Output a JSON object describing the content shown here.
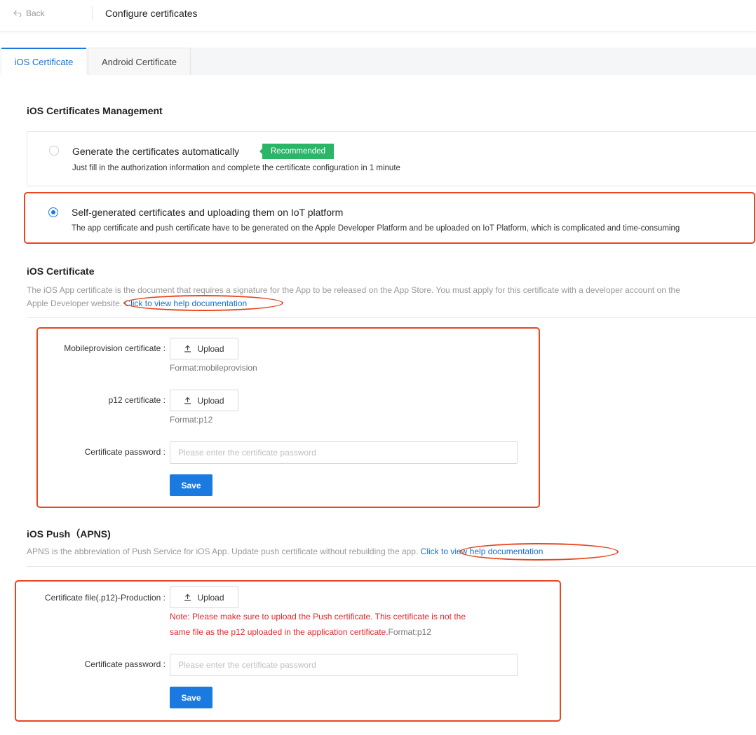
{
  "header": {
    "back_label": "Back",
    "title": "Configure certificates"
  },
  "tabs": [
    {
      "label": "iOS Certificate",
      "active": true
    },
    {
      "label": "Android Certificate",
      "active": false
    }
  ],
  "management": {
    "title": "iOS Certificates Management",
    "options": [
      {
        "title": "Generate the certificates automatically",
        "badge": "Recommended",
        "description": "Just fill in the authorization information and complete the certificate configuration in 1 minute",
        "selected": false
      },
      {
        "title": "Self-generated certificates and uploading them on IoT platform",
        "description": "The app certificate and push certificate have to be generated on the Apple Developer Platform and be uploaded on IoT Platform, which is complicated and time-consuming",
        "selected": true
      }
    ]
  },
  "ios_certificate": {
    "title": "iOS Certificate",
    "description_line1": "The iOS App certificate is the document that requires a signature for the App to be released on the App Store. You must apply for this certificate with a developer account on the",
    "description_line2": "Apple Developer website.",
    "help_link": "Click to view help documentation",
    "fields": {
      "mobileprovision_label": "Mobileprovision certificate :",
      "mobileprovision_format": "Format:mobileprovision",
      "p12_label": "p12 certificate :",
      "p12_format": "Format:p12",
      "password_label": "Certificate password :",
      "password_placeholder": "Please enter the certificate password",
      "password_value": ""
    },
    "upload_label": "Upload",
    "save_label": "Save"
  },
  "ios_push": {
    "title": "iOS Push（APNS)",
    "description": "APNS is the abbreviation of Push Service for iOS App. Update push certificate without rebuilding the app.",
    "help_link": "Click to view help documentation",
    "fields": {
      "cert_file_label": "Certificate file(.p12)-Production :",
      "note_line1": "Note: Please make sure to upload the Push certificate. This certificate is not the",
      "note_line2": "same file as the p12 uploaded in the application certificate.",
      "note_format": "Format:p12",
      "password_label": "Certificate password :",
      "password_placeholder": "Please enter the certificate password",
      "password_value": ""
    },
    "upload_label": "Upload",
    "save_label": "Save"
  },
  "colors": {
    "accent": "#1a7ae0",
    "badge_green": "#2bb567",
    "annotation_red": "#e8461f",
    "note_red": "#e0262c"
  }
}
